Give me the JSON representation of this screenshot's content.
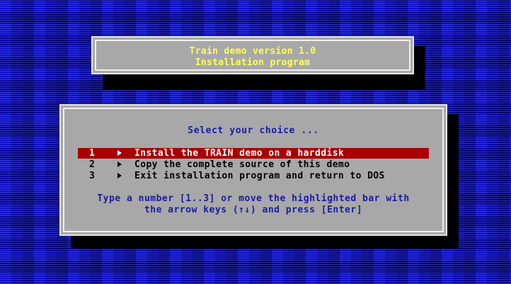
{
  "header": {
    "title": "Train demo version 1.0",
    "subtitle": "Installation program"
  },
  "menu": {
    "prompt": "Select your choice ...",
    "selected_index": 1,
    "items": [
      {
        "number": "1",
        "label": "Install the TRAIN demo on a harddisk"
      },
      {
        "number": "2",
        "label": "Copy the complete source of this demo"
      },
      {
        "number": "3",
        "label": "Exit installation program and return to DOS"
      }
    ],
    "hint_line1": "Type a number [1..3] or move the highlighted bar with",
    "hint_line2": "the arrow keys (↑↓) and press [Enter]"
  },
  "colors": {
    "background": "#1a1fbf",
    "panel": "#a8a8a8",
    "title_text": "#ffff55",
    "menu_text": "#1b1b9e",
    "highlight": "#a80000"
  }
}
